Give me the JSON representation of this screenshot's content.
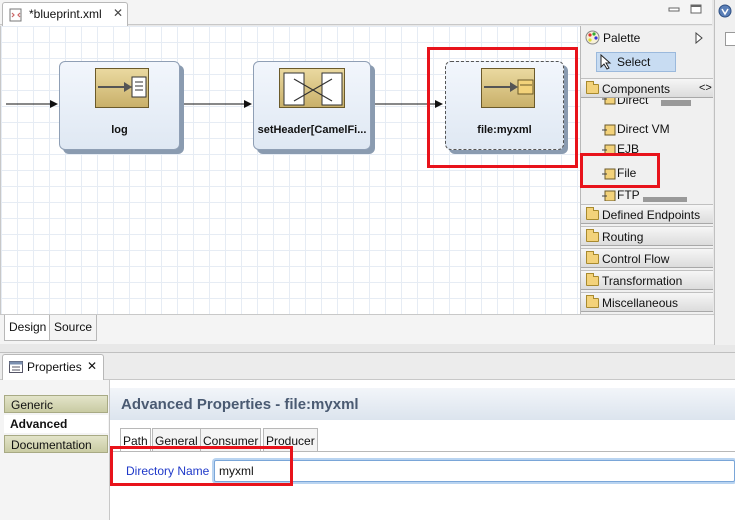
{
  "editor": {
    "tab_title": "*blueprint.xml",
    "close_glyph": "✕"
  },
  "route": {
    "nodes": [
      {
        "label": "log",
        "icon": "log-file-icon"
      },
      {
        "label": "setHeader[CamelFi...",
        "icon": "set-header-icon"
      },
      {
        "label": "file:myxml",
        "icon": "file-folder-icon"
      }
    ]
  },
  "palette": {
    "title": "Palette",
    "select_label": "Select",
    "components_label": "Components",
    "components": [
      {
        "label": "Direct",
        "icon": "endpoint-icon"
      },
      {
        "label": "Direct VM",
        "icon": "endpoint-icon"
      },
      {
        "label": "EJB",
        "icon": "endpoint-icon"
      },
      {
        "label": "File",
        "icon": "endpoint-icon"
      },
      {
        "label": "FTP",
        "icon": "endpoint-icon"
      }
    ],
    "drawers": [
      {
        "label": "Defined Endpoints"
      },
      {
        "label": "Routing"
      },
      {
        "label": "Control Flow"
      },
      {
        "label": "Transformation"
      },
      {
        "label": "Miscellaneous"
      }
    ]
  },
  "editor_tabs": {
    "design": "Design",
    "source": "Source"
  },
  "properties": {
    "view_title": "Properties",
    "close_glyph": "✕",
    "side_tabs": [
      {
        "label": "Generic",
        "active": false
      },
      {
        "label": "Advanced",
        "active": true
      },
      {
        "label": "Documentation",
        "active": false
      }
    ],
    "header": "Advanced Properties - file:myxml",
    "sub_tabs": [
      {
        "label": "Path"
      },
      {
        "label": "General"
      },
      {
        "label": "Consumer"
      },
      {
        "label": "Producer"
      }
    ],
    "directory_label": "Directory Name",
    "directory_value": "myxml"
  },
  "colors": {
    "highlight": "#e8131b",
    "node_icon": "#c9b06a",
    "field_label": "#1f39c9"
  }
}
